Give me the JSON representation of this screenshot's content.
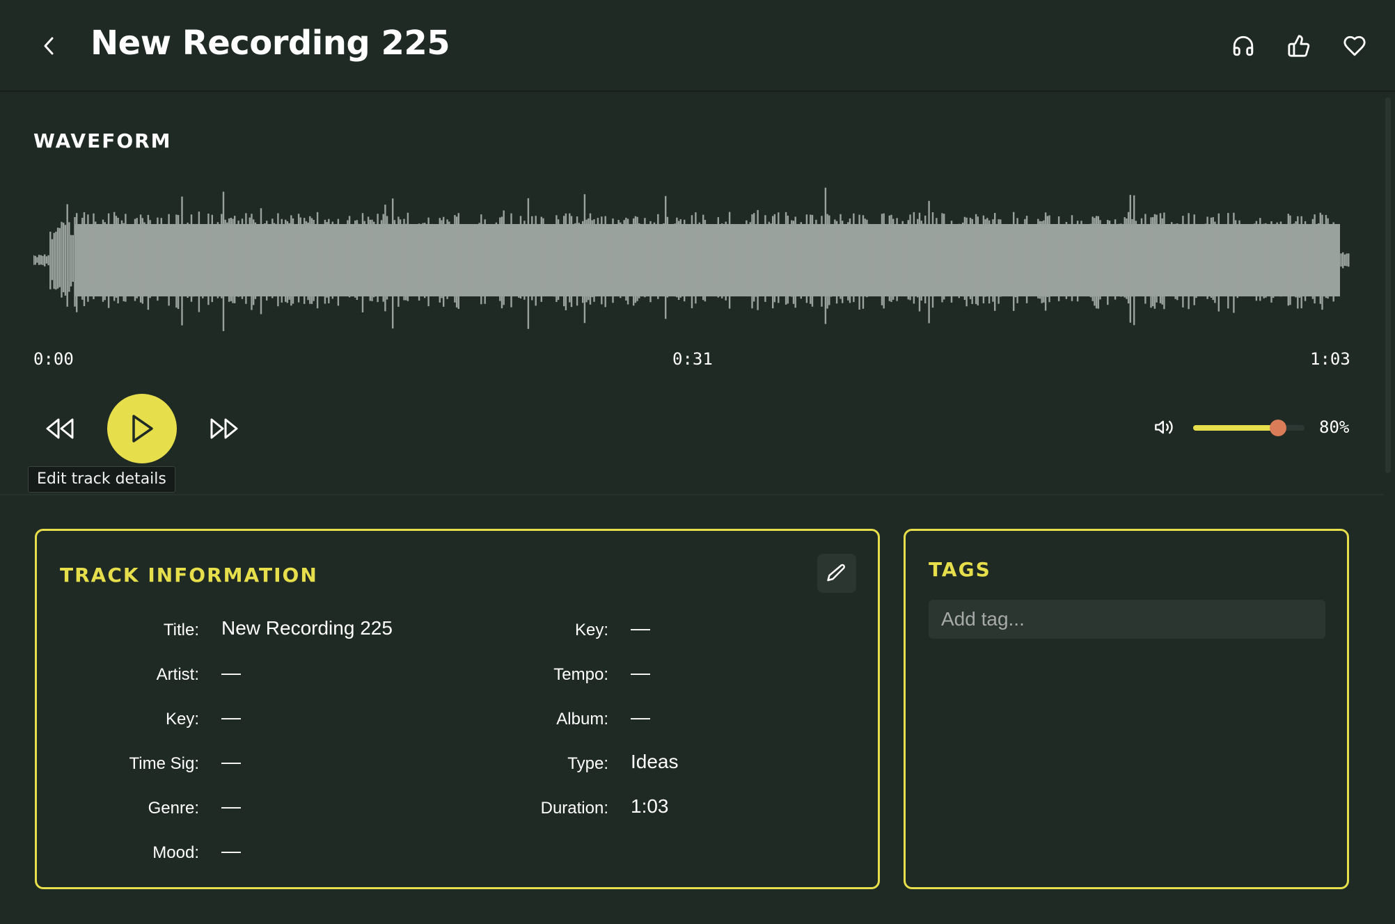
{
  "header": {
    "back_icon": "chevron-left-icon",
    "title": "New Recording 225",
    "icons": [
      "headphones-icon",
      "thumbs-up-icon",
      "heart-icon"
    ]
  },
  "waveform": {
    "section_title": "WAVEFORM",
    "time_start": "0:00",
    "time_mid": "0:31",
    "time_end": "1:03",
    "color": "#9aa29e"
  },
  "player": {
    "rewind_icon": "rewind-icon",
    "play_icon": "play-icon",
    "forward_icon": "fast-forward-icon",
    "tooltip": "Edit track details",
    "volume_icon": "volume-icon",
    "volume_percent": 80,
    "volume_label": "80%"
  },
  "track_info": {
    "section_title": "TRACK INFORMATION",
    "edit_icon": "pencil-icon",
    "left": [
      {
        "label": "Title:",
        "value": "New Recording 225"
      },
      {
        "label": "Artist:",
        "value": "—"
      },
      {
        "label": "Key:",
        "value": "—"
      },
      {
        "label": "Time Sig:",
        "value": "—"
      },
      {
        "label": "Genre:",
        "value": "—"
      },
      {
        "label": "Mood:",
        "value": "—"
      }
    ],
    "right": [
      {
        "label": "Key:",
        "value": "—"
      },
      {
        "label": "Tempo:",
        "value": "—"
      },
      {
        "label": "Album:",
        "value": "—"
      },
      {
        "label": "Type:",
        "value": "Ideas"
      },
      {
        "label": "Duration:",
        "value": "1:03"
      }
    ]
  },
  "tags": {
    "section_title": "TAGS",
    "input_placeholder": "Add tag...",
    "input_value": ""
  },
  "colors": {
    "background": "#1f2a25",
    "accent": "#e7de4c",
    "slider_thumb": "#d97c57"
  }
}
